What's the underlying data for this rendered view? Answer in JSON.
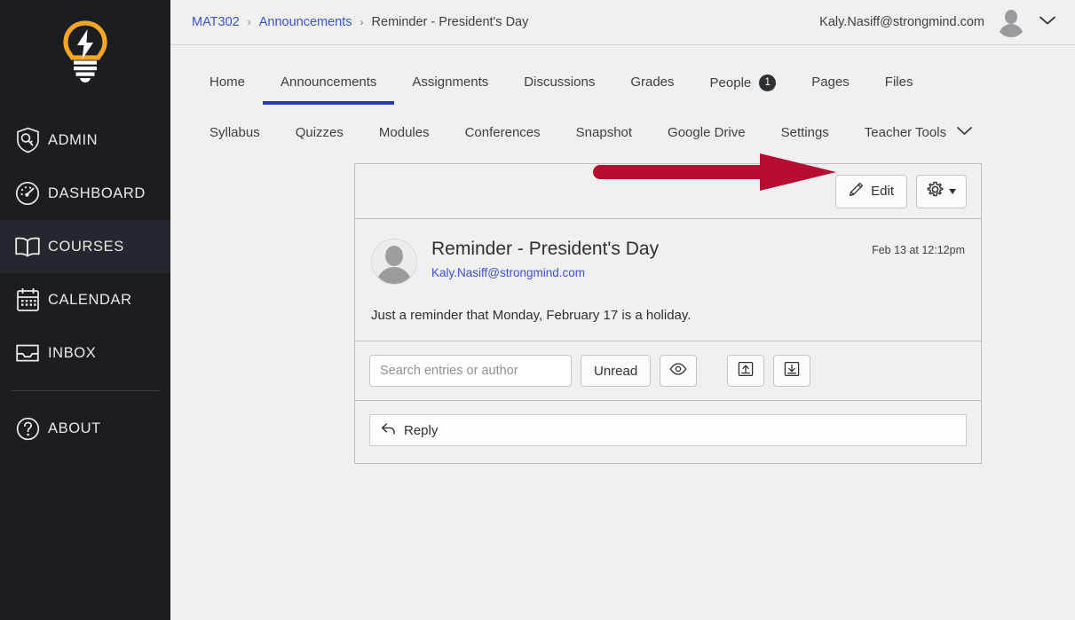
{
  "sidebar": {
    "logo": "lightbulb-logo",
    "items": [
      {
        "label": "ADMIN",
        "icon": "shield-icon",
        "active": false
      },
      {
        "label": "DASHBOARD",
        "icon": "gauge-icon",
        "active": false
      },
      {
        "label": "COURSES",
        "icon": "book-icon",
        "active": true
      },
      {
        "label": "CALENDAR",
        "icon": "calendar-icon",
        "active": false
      },
      {
        "label": "INBOX",
        "icon": "inbox-icon",
        "active": false
      },
      {
        "label": "ABOUT",
        "icon": "question-circle-icon",
        "active": false
      }
    ],
    "collapse_icon": "chevron-left-icon"
  },
  "topbar": {
    "breadcrumb": {
      "course": "MAT302",
      "section": "Announcements",
      "current": "Reminder - President's Day",
      "separator": "›"
    },
    "user_email": "Kaly.Nasiff@strongmind.com",
    "avatar_icon": "user-avatar-icon",
    "chevron_icon": "chevron-down-icon"
  },
  "course_nav": {
    "row1": [
      {
        "label": "Home",
        "active": false
      },
      {
        "label": "Announcements",
        "active": true
      },
      {
        "label": "Assignments",
        "active": false
      },
      {
        "label": "Discussions",
        "active": false
      },
      {
        "label": "Grades",
        "active": false
      },
      {
        "label": "People",
        "active": false,
        "badge": "1"
      },
      {
        "label": "Pages",
        "active": false
      },
      {
        "label": "Files",
        "active": false
      }
    ],
    "row2": [
      {
        "label": "Syllabus"
      },
      {
        "label": "Quizzes"
      },
      {
        "label": "Modules"
      },
      {
        "label": "Conferences"
      },
      {
        "label": "Snapshot"
      },
      {
        "label": "Google Drive"
      },
      {
        "label": "Settings"
      }
    ],
    "teacher_tools": {
      "label": "Teacher Tools",
      "chevron_icon": "chevron-down-icon"
    },
    "active_underline_color": "#2438ba"
  },
  "toolbar": {
    "edit_label": "Edit",
    "edit_icon": "pencil-icon",
    "gear_icon": "gear-icon",
    "gear_caret_icon": "caret-down-icon"
  },
  "annotation": {
    "type": "arrow",
    "color": "#b80d33",
    "points_to": "edit-button"
  },
  "announcement": {
    "title": "Reminder - President's Day",
    "author": "Kaly.Nasiff@strongmind.com",
    "date": "Feb 13 at 12:12pm",
    "body": "Just a reminder that Monday, February 17 is a holiday.",
    "avatar_icon": "user-avatar-icon"
  },
  "filters": {
    "search_placeholder": "Search entries or author",
    "search_value": "",
    "unread_label": "Unread",
    "eye_icon": "eye-icon",
    "collapse_icon": "collapse-replies-icon",
    "expand_icon": "expand-replies-icon"
  },
  "reply": {
    "label": "Reply",
    "icon": "reply-arrow-icon"
  }
}
